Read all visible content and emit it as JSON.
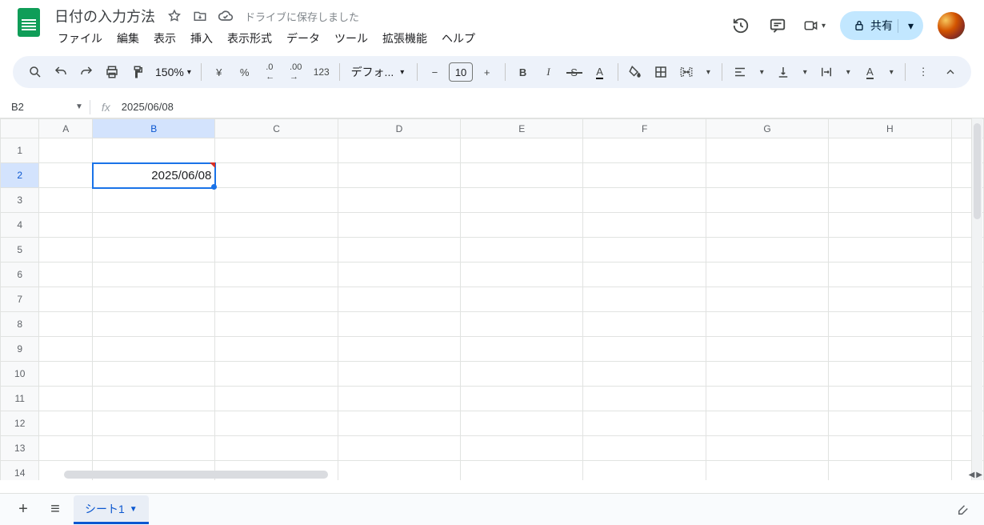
{
  "doc_title": "日付の入力方法",
  "save_status": "ドライブに保存しました",
  "menu": [
    "ファイル",
    "編集",
    "表示",
    "挿入",
    "表示形式",
    "データ",
    "ツール",
    "拡張機能",
    "ヘルプ"
  ],
  "share_label": "共有",
  "toolbar": {
    "zoom": "150%",
    "currency": "¥",
    "percent": "%",
    "dec_less": ".0",
    "dec_more": ".00",
    "num_123": "123",
    "font": "デフォ...",
    "font_size": "10",
    "more": "⋮"
  },
  "namebox": "B2",
  "formula": "2025/06/08",
  "columns": [
    "A",
    "B",
    "C",
    "D",
    "E",
    "F",
    "G",
    "H"
  ],
  "rows": [
    "1",
    "2",
    "3",
    "4",
    "5",
    "6",
    "7",
    "8",
    "9",
    "10",
    "11",
    "12",
    "13",
    "14"
  ],
  "selected_cell": {
    "row": "2",
    "col": "B",
    "value": "2025/06/08"
  },
  "sheet_tab": "シート1"
}
